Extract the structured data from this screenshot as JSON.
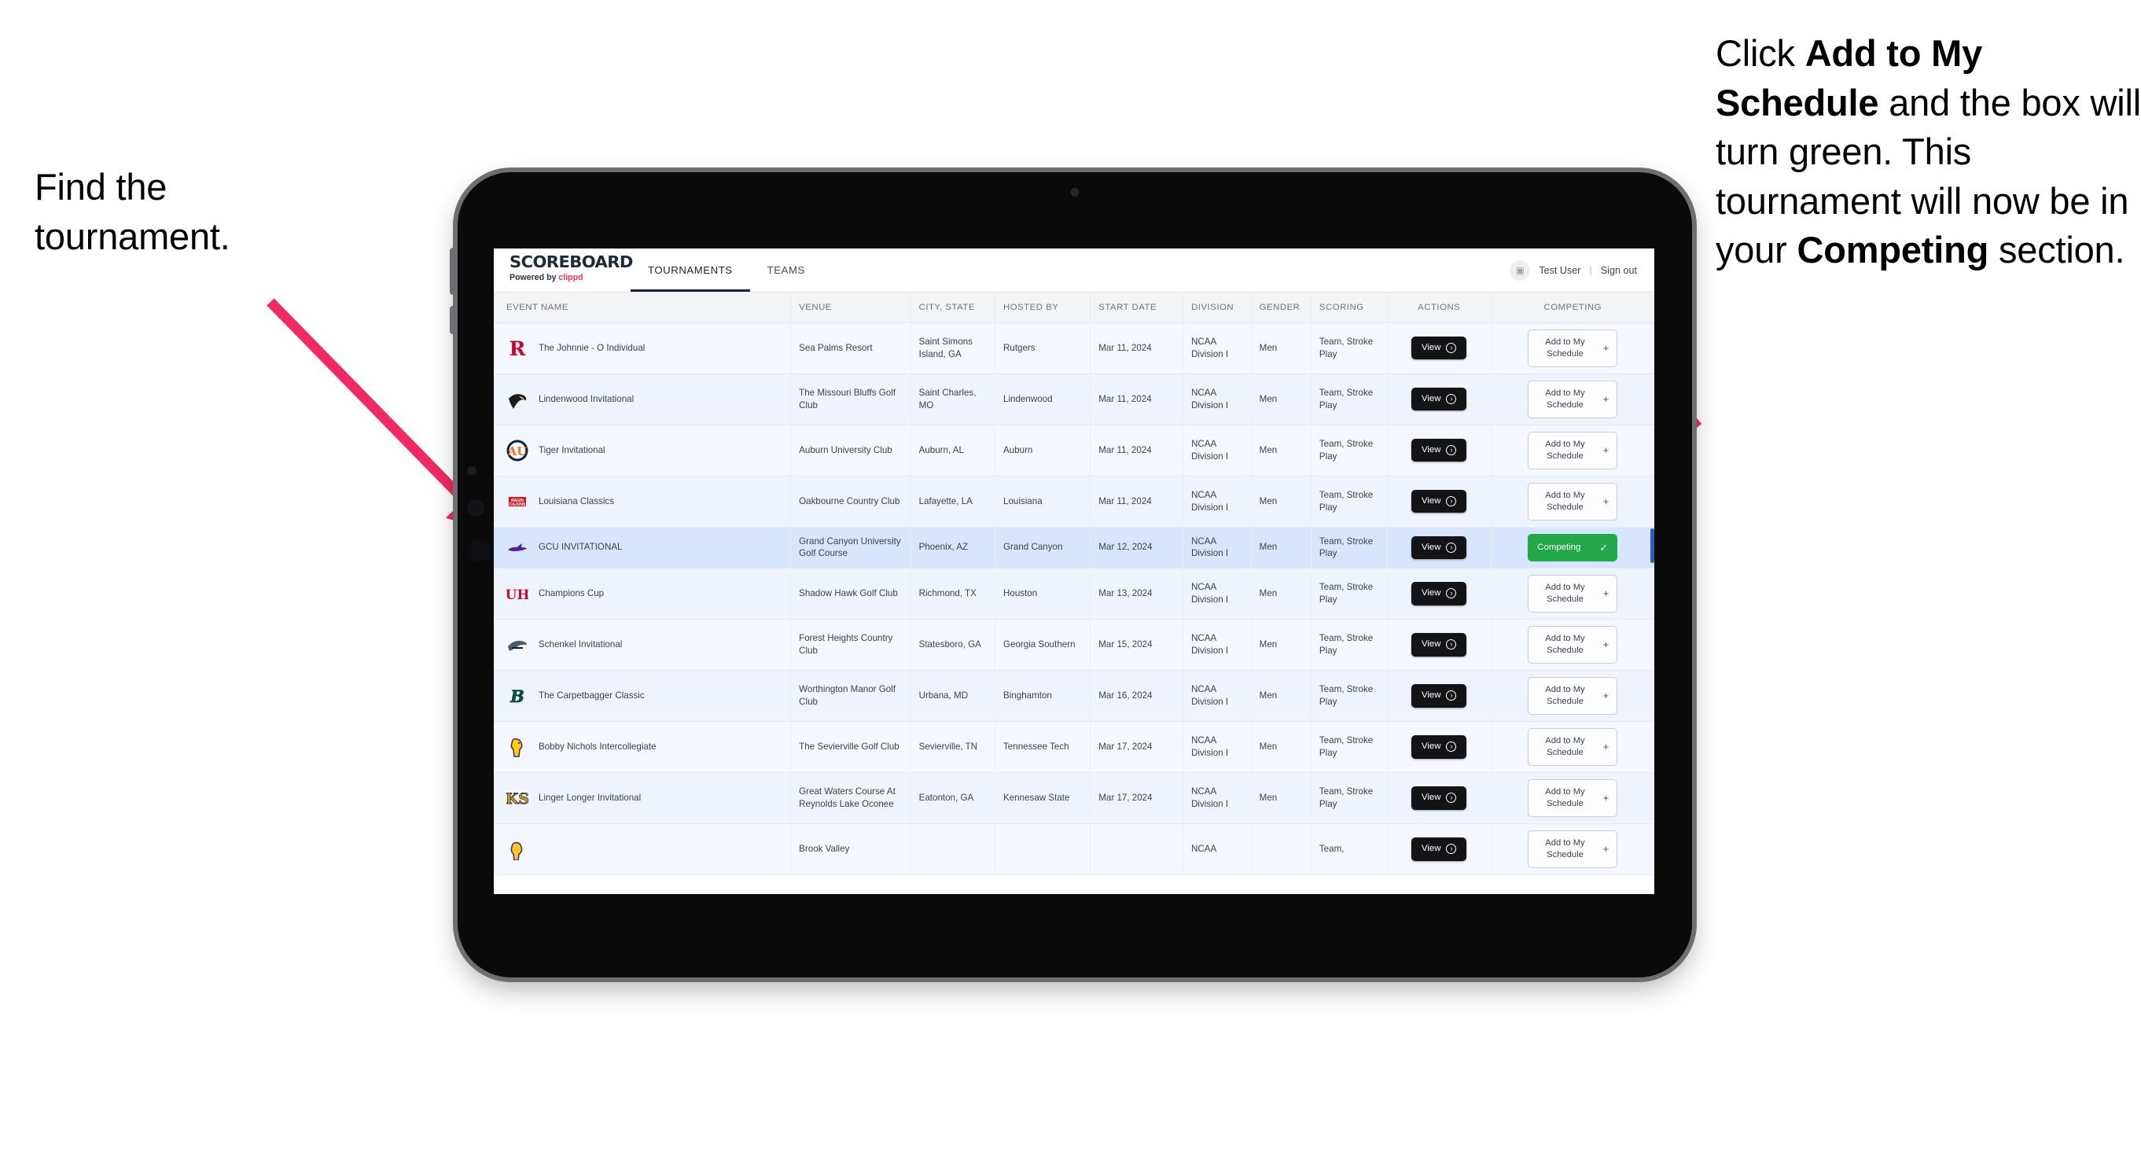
{
  "annotations": {
    "left": "Find the tournament.",
    "right_parts": [
      {
        "t": "Click ",
        "b": false
      },
      {
        "t": "Add to My Schedule",
        "b": true
      },
      {
        "t": " and the box will turn green. This tournament will now be in your ",
        "b": false
      },
      {
        "t": "Competing",
        "b": true
      },
      {
        "t": " section.",
        "b": false
      }
    ]
  },
  "app": {
    "brand": {
      "name": "SCOREBOARD",
      "powered_prefix": "Powered by ",
      "powered_by": "clippd"
    },
    "tabs": [
      {
        "label": "TOURNAMENTS",
        "active": true
      },
      {
        "label": "TEAMS",
        "active": false
      }
    ],
    "user": {
      "avatar_icon": "user-avatar-icon",
      "name": "Test User",
      "separator": "|",
      "signout": "Sign out"
    }
  },
  "table": {
    "headers": [
      "EVENT NAME",
      "VENUE",
      "CITY, STATE",
      "HOSTED BY",
      "START DATE",
      "DIVISION",
      "GENDER",
      "SCORING",
      "ACTIONS",
      "COMPETING"
    ],
    "view_label": "View",
    "view_icon": "arrow-right-circle-icon",
    "add_label": "Add to My Schedule",
    "add_icon": "plus-icon",
    "competing_label": "Competing",
    "competing_icon": "check-icon",
    "competing_color": "#22a84a",
    "rows": [
      {
        "event": "The Johnnie - O Individual",
        "venue": "Sea Palms Resort",
        "city": "Saint Simons Island, GA",
        "host": "Rutgers",
        "date": "Mar 11, 2024",
        "division": "NCAA Division I",
        "gender": "Men",
        "scoring": "Team, Stroke Play",
        "competing": false,
        "logo": "rutgers-logo"
      },
      {
        "event": "Lindenwood Invitational",
        "venue": "The Missouri Bluffs Golf Club",
        "city": "Saint Charles, MO",
        "host": "Lindenwood",
        "date": "Mar 11, 2024",
        "division": "NCAA Division I",
        "gender": "Men",
        "scoring": "Team, Stroke Play",
        "competing": false,
        "logo": "lindenwood-logo"
      },
      {
        "event": "Tiger Invitational",
        "venue": "Auburn University Club",
        "city": "Auburn, AL",
        "host": "Auburn",
        "date": "Mar 11, 2024",
        "division": "NCAA Division I",
        "gender": "Men",
        "scoring": "Team, Stroke Play",
        "competing": false,
        "logo": "auburn-logo"
      },
      {
        "event": "Louisiana Classics",
        "venue": "Oakbourne Country Club",
        "city": "Lafayette, LA",
        "host": "Louisiana",
        "date": "Mar 11, 2024",
        "division": "NCAA Division I",
        "gender": "Men",
        "scoring": "Team, Stroke Play",
        "competing": false,
        "logo": "louisiana-logo"
      },
      {
        "event": "GCU INVITATIONAL",
        "venue": "Grand Canyon University Golf Course",
        "city": "Phoenix, AZ",
        "host": "Grand Canyon",
        "date": "Mar 12, 2024",
        "division": "NCAA Division I",
        "gender": "Men",
        "scoring": "Team, Stroke Play",
        "competing": true,
        "logo": "gcu-lopes-logo"
      },
      {
        "event": "Champions Cup",
        "venue": "Shadow Hawk Golf Club",
        "city": "Richmond, TX",
        "host": "Houston",
        "date": "Mar 13, 2024",
        "division": "NCAA Division I",
        "gender": "Men",
        "scoring": "Team, Stroke Play",
        "competing": false,
        "logo": "houston-logo"
      },
      {
        "event": "Schenkel Invitational",
        "venue": "Forest Heights Country Club",
        "city": "Statesboro, GA",
        "host": "Georgia Southern",
        "date": "Mar 15, 2024",
        "division": "NCAA Division I",
        "gender": "Men",
        "scoring": "Team, Stroke Play",
        "competing": false,
        "logo": "georgia-southern-logo"
      },
      {
        "event": "The Carpetbagger Classic",
        "venue": "Worthington Manor Golf Club",
        "city": "Urbana, MD",
        "host": "Binghamton",
        "date": "Mar 16, 2024",
        "division": "NCAA Division I",
        "gender": "Men",
        "scoring": "Team, Stroke Play",
        "competing": false,
        "logo": "binghamton-logo"
      },
      {
        "event": "Bobby Nichols Intercollegiate",
        "venue": "The Sevierville Golf Club",
        "city": "Sevierville, TN",
        "host": "Tennessee Tech",
        "date": "Mar 17, 2024",
        "division": "NCAA Division I",
        "gender": "Men",
        "scoring": "Team, Stroke Play",
        "competing": false,
        "logo": "tennessee-tech-logo"
      },
      {
        "event": "Linger Longer Invitational",
        "venue": "Great Waters Course At Reynolds Lake Oconee",
        "city": "Eatonton, GA",
        "host": "Kennesaw State",
        "date": "Mar 17, 2024",
        "division": "NCAA Division I",
        "gender": "Men",
        "scoring": "Team, Stroke Play",
        "competing": false,
        "logo": "kennesaw-state-logo"
      },
      {
        "event": "",
        "venue": "Brook Valley",
        "city": "",
        "host": "",
        "date": "",
        "division": "NCAA",
        "gender": "",
        "scoring": "Team,",
        "competing": false,
        "logo": "partial-row-logo"
      }
    ]
  }
}
